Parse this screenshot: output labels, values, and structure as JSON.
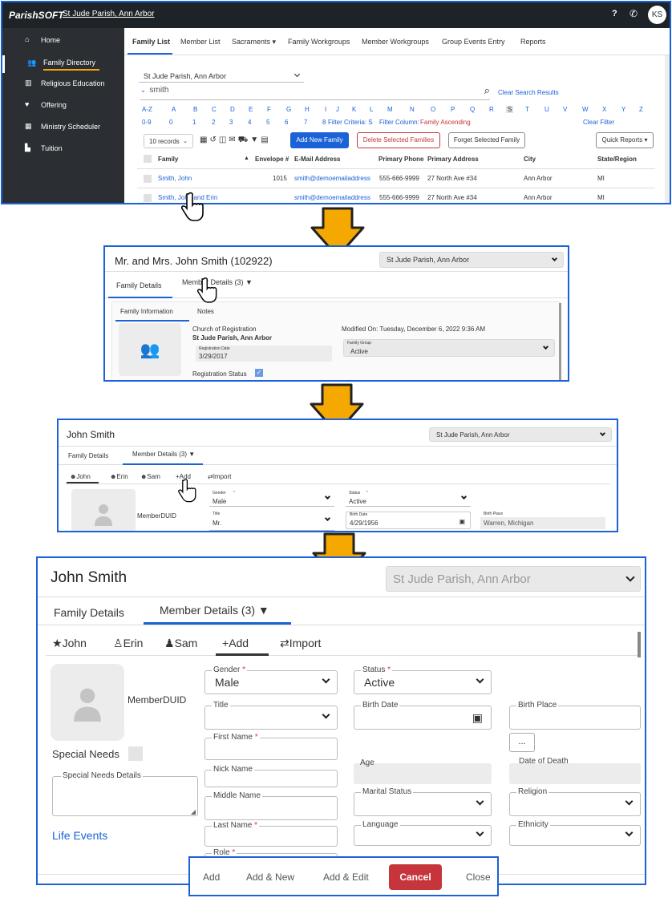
{
  "panel1": {
    "logo": "ParishSOFT",
    "parish": "St Jude Parish, Ann Arbor",
    "avatar": "KS",
    "help_icon": "?",
    "phone_icon": "✆",
    "sidebar": [
      {
        "label": "Home",
        "icon": "home-icon"
      },
      {
        "label": "Family Directory",
        "icon": "people-icon"
      },
      {
        "label": "Religious Education",
        "icon": "school-icon"
      },
      {
        "label": "Offering",
        "icon": "heart-icon"
      },
      {
        "label": "Ministry Scheduler",
        "icon": "calendar-icon"
      },
      {
        "label": "Tuition",
        "icon": "building-icon"
      }
    ],
    "tabs": [
      "Family List",
      "Member List",
      "Sacraments ▾",
      "Family Workgroups",
      "Member Workgroups",
      "Group Events Entry",
      "Reports"
    ],
    "parish_select": "St Jude Parish, Ann Arbor",
    "search_value": "smith",
    "clear_search": "Clear Search Results",
    "alpha": [
      "A-Z",
      "A",
      "B",
      "C",
      "D",
      "E",
      "F",
      "G",
      "H",
      "I",
      "J",
      "K",
      "L",
      "M",
      "N",
      "O",
      "P",
      "Q",
      "R",
      "S",
      "T",
      "U",
      "V",
      "W",
      "X",
      "Y",
      "Z"
    ],
    "nums": [
      "0-9",
      "0",
      "1",
      "2",
      "3",
      "4",
      "5",
      "6",
      "7",
      "8",
      "9"
    ],
    "filter_criteria": "Filter Criteria: S",
    "filter_column": "Filter Column:",
    "filter_column_val": "Family Ascending",
    "clear_filter": "Clear Filter",
    "records": "10 records",
    "add_family": "Add New Family",
    "delete_families": "Delete Selected Families",
    "forget_family": "Forget Selected Family",
    "quick_reports": "Quick Reports",
    "columns": [
      "Family",
      "Envelope #",
      "E-Mail Address",
      "Primary Phone",
      "Primary Address",
      "City",
      "State/Region"
    ],
    "rows": [
      {
        "family": "Smith, John",
        "envelope": "1015",
        "email": "smith@demoemailaddress",
        "phone": "555-666-9999",
        "address": "27 North Ave #34",
        "city": "Ann Arbor",
        "state": "MI"
      },
      {
        "family": "Smith, John and Erin",
        "envelope": "",
        "email": "smith@demoemailaddress",
        "phone": "555-666-9999",
        "address": "27 North Ave #34",
        "city": "Ann Arbor",
        "state": "MI"
      }
    ]
  },
  "panel2": {
    "title": "Mr. and Mrs. John Smith (102922)",
    "parish": "St Jude Parish, Ann Arbor",
    "tab_family": "Family Details",
    "tab_member": "Member Details (3)",
    "subtab_info": "Family Information",
    "subtab_notes": "Notes",
    "church_label": "Church of Registration",
    "church_value": "St Jude Parish, Ann Arbor",
    "reg_date_label": "Registration Date",
    "reg_date": "3/29/2017",
    "reg_status": "Registration Status",
    "modified": "Modified On: Tuesday, December 6, 2022 9:36 AM",
    "family_group_label": "Family Group",
    "family_group": "Active"
  },
  "panel3": {
    "title": "John Smith",
    "parish": "St Jude Parish, Ann Arbor",
    "tab_family": "Family Details",
    "tab_member": "Member Details (3)",
    "members": [
      "John",
      "Erin",
      "Sam",
      "Add",
      "Import"
    ],
    "member_duid": "MemberDUID",
    "gender_label": "Gender",
    "gender": "Male",
    "status_label": "Status",
    "status": "Active",
    "title_label": "Title",
    "title_val": "Mr.",
    "birth_label": "Birth Date",
    "birth": "4/29/1956",
    "birthplace_label": "Birth Place",
    "birthplace": "Warren, Michigan"
  },
  "panel4": {
    "title": "John Smith",
    "parish": "St Jude Parish, Ann Arbor",
    "tab_family": "Family Details",
    "tab_member": "Member Details (3)",
    "members": [
      "John",
      "Erin",
      "Sam",
      "Add",
      "Import"
    ],
    "member_duid": "MemberDUID",
    "special_needs": "Special Needs",
    "special_needs_details": "Special Needs Details",
    "life_events": "Life Events",
    "gender_label": "Gender",
    "gender": "Male",
    "status_label": "Status",
    "status": "Active",
    "title_label": "Title",
    "birth_label": "Birth Date",
    "birthplace_label": "Birth Place",
    "more": "...",
    "first_name": "First Name",
    "age": "Age",
    "death": "Date of Death",
    "nick_name": "Nick Name",
    "middle_name": "Middle Name",
    "marital": "Marital Status",
    "religion": "Religion",
    "last_name": "Last Name",
    "language": "Language",
    "ethnicity": "Ethnicity",
    "role": "Role"
  },
  "actions": {
    "add": "Add",
    "add_new": "Add & New",
    "add_edit": "Add & Edit",
    "cancel": "Cancel",
    "close": "Close"
  },
  "colors": {
    "frame": "#1a62d6",
    "arrow": "#f5a800",
    "sidebar": "#2b2f33",
    "topbar": "#1e2327",
    "link": "#1a62d6",
    "cancel": "#c7353c"
  }
}
